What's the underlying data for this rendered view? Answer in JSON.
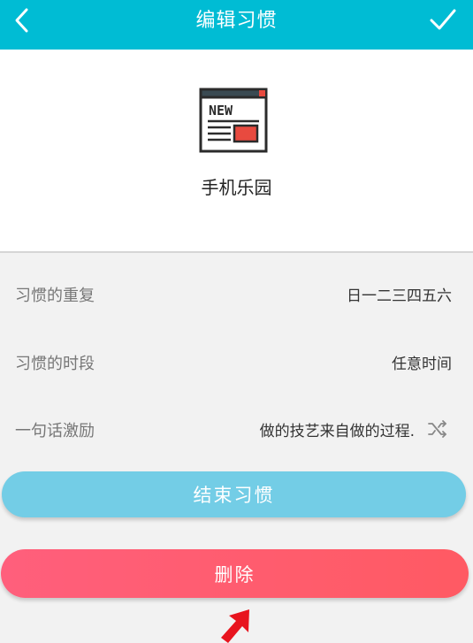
{
  "header": {
    "title": "编辑习惯",
    "back_icon": "chevron-left-icon",
    "confirm_icon": "checkmark-icon"
  },
  "habit": {
    "icon": "news-app-icon",
    "icon_text": "NEW",
    "name": "手机乐园"
  },
  "settings": {
    "repeat": {
      "label": "习惯的重复",
      "value": "日一二三四五六"
    },
    "period": {
      "label": "习惯的时段",
      "value": "任意时间"
    },
    "motto": {
      "label": "一句话激励",
      "value": "做的技艺来自做的过程.",
      "shuffle_icon": "shuffle-icon"
    }
  },
  "actions": {
    "end_label": "结束习惯",
    "delete_label": "删除"
  },
  "annotation": {
    "arrow_icon": "red-arrow-icon"
  },
  "colors": {
    "header_bg": "#00bcd4",
    "end_button": "#73cde6",
    "delete_button": "#ff5a6a",
    "annotation": "#e8141e"
  }
}
